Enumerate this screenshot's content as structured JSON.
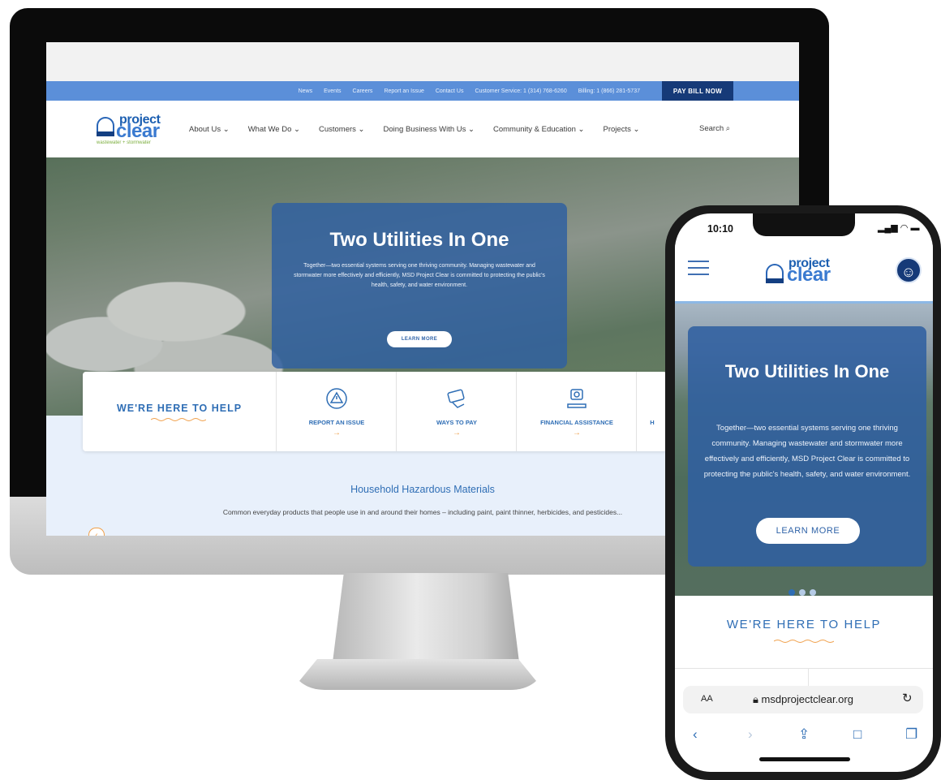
{
  "desktop": {
    "topbar": {
      "links": [
        "News",
        "Events",
        "Careers",
        "Report an Issue",
        "Contact Us",
        "Customer Service: 1 (314) 768-6260",
        "Billing: 1 (866) 281-5737"
      ],
      "pay_bill": "PAY BILL NOW"
    },
    "logo": {
      "top": "project",
      "bottom": "clear",
      "tagline": "wastewater + stormwater"
    },
    "nav": {
      "items": [
        "About Us ⌄",
        "What We Do ⌄",
        "Customers ⌄",
        "Doing Business With Us ⌄",
        "Community & Education ⌄",
        "Projects ⌄"
      ],
      "search": "Search"
    },
    "hero": {
      "title": "Two Utilities In One",
      "text": "Together—two essential systems serving one thriving community. Managing wastewater and stormwater more effectively and efficiently, MSD Project Clear is committed to protecting the public's health, safety, and water environment.",
      "button": "LEARN MORE"
    },
    "help": {
      "title": "WE'RE HERE TO HELP",
      "items": [
        {
          "label": "REPORT AN ISSUE",
          "icon": "warning-icon"
        },
        {
          "label": "WAYS TO PAY",
          "icon": "payment-icon"
        },
        {
          "label": "FINANCIAL ASSISTANCE",
          "icon": "assistance-icon"
        },
        {
          "label": "H",
          "icon": "more-icon"
        }
      ],
      "arrow": "→"
    },
    "feature": {
      "title": "Household Hazardous Materials",
      "text": "Common everyday products that people use in and around their homes – including paint, paint thinner, herbicides, and pesticides..."
    }
  },
  "phone": {
    "time": "10:10",
    "logo": {
      "top": "project",
      "bottom": "clear"
    },
    "hero": {
      "title": "Two Utilities In One",
      "text": "Together—two essential systems serving one thriving community. Managing wastewater and stormwater more effectively and efficiently, MSD Project Clear is committed to protecting the public's health, safety, and water environment.",
      "button": "LEARN MORE"
    },
    "help_title": "WE'RE HERE TO HELP",
    "browser": {
      "aa": "AA",
      "url": "msdprojectclear.org"
    }
  },
  "colors": {
    "brand_blue": "#2f6eb5",
    "topbar": "#5b8fd9",
    "pay_bill_bg": "#163a78",
    "accent_orange": "#f0a04b"
  }
}
